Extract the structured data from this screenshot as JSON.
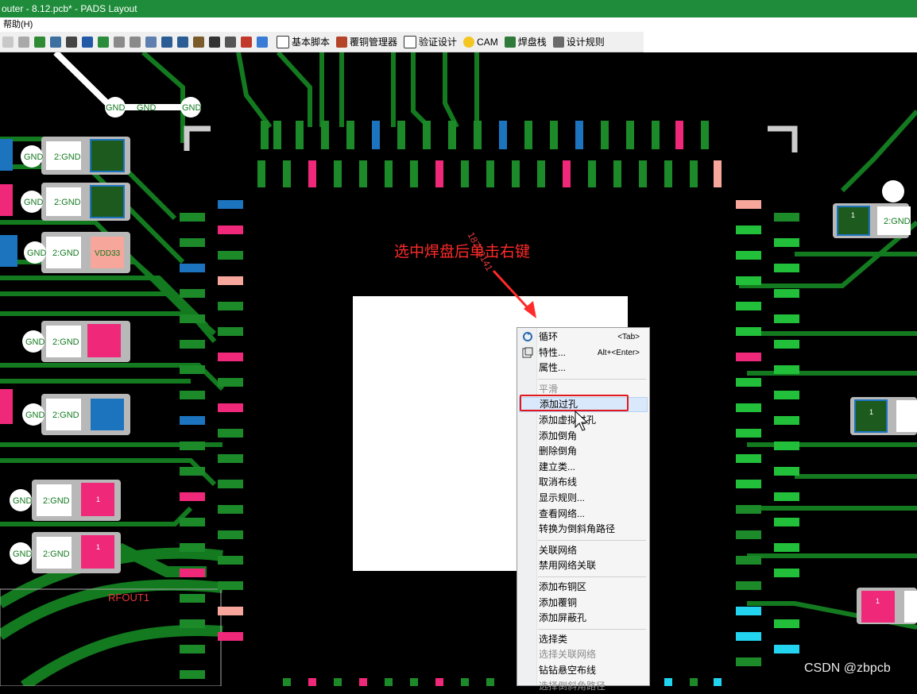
{
  "window": {
    "title": "outer - 8.12.pcb* - PADS Layout"
  },
  "menubar": {
    "help": "帮助(H)"
  },
  "toolbar": {
    "buttons": [
      {
        "label": "基本脚本",
        "icon": "script-icon"
      },
      {
        "label": "覆铜管理器",
        "icon": "house-icon"
      },
      {
        "label": "验证设计",
        "icon": "window-icon"
      },
      {
        "label": "CAM",
        "icon": "smiley-icon"
      },
      {
        "label": "焊盘栈",
        "icon": "pad-icon"
      },
      {
        "label": "设计规则",
        "icon": "rules-icon"
      }
    ]
  },
  "pcb": {
    "net_labels": {
      "gnd": "GND",
      "gnd2": "2:GND",
      "vdd": "VDD33",
      "rfout": "RFOUT1",
      "one": "1"
    },
    "colors": {
      "trace": "#137a1f",
      "pad_green": "#1d8a2a",
      "pad_pink": "#f0287a",
      "pad_blue": "#1c74bf",
      "pad_cyan": "#22d4f0"
    }
  },
  "annotation": {
    "text": "选中焊盘后单击右键",
    "color": "#ff2a2a"
  },
  "diagonal_text": "18776141",
  "context_menu": {
    "items": [
      {
        "label": "循环",
        "shortcut": "<Tab>",
        "icon": "cycle-icon"
      },
      {
        "label": "特性...",
        "shortcut": "Alt+<Enter>",
        "icon": "properties-icon"
      },
      {
        "label": "属性..."
      },
      {
        "sep": true
      },
      {
        "label": "平滑",
        "disabled": true
      },
      {
        "label": "添加过孔",
        "highlighted": true
      },
      {
        "label": "添加虚拟过孔"
      },
      {
        "label": "添加倒角"
      },
      {
        "label": "删除倒角"
      },
      {
        "label": "建立类..."
      },
      {
        "label": "取消布线"
      },
      {
        "label": "显示规则..."
      },
      {
        "label": "查看网络..."
      },
      {
        "label": "转换为倒斜角路径"
      },
      {
        "sep": true
      },
      {
        "label": "关联网络"
      },
      {
        "label": "禁用网络关联"
      },
      {
        "sep": true
      },
      {
        "label": "添加布铜区"
      },
      {
        "label": "添加覆铜"
      },
      {
        "label": "添加屏蔽孔"
      },
      {
        "sep": true
      },
      {
        "label": "选择类"
      },
      {
        "label": "选择关联网络",
        "disabled": true
      },
      {
        "label": "钻钻悬空布线"
      },
      {
        "label": "选择倒斜角路径",
        "disabled": true
      }
    ]
  },
  "watermark": "CSDN @zbpcb"
}
